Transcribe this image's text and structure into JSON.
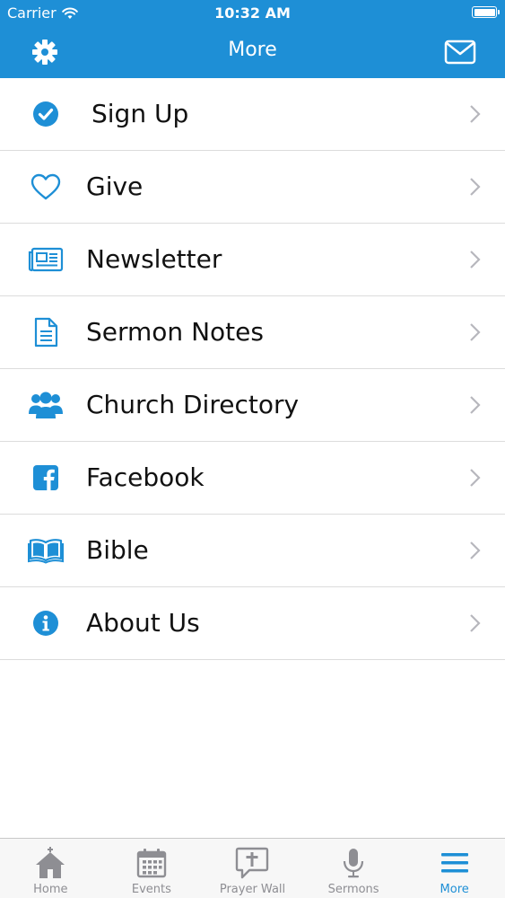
{
  "status_bar": {
    "carrier": "Carrier",
    "time": "10:32 AM",
    "wifi_icon": "wifi-icon",
    "battery_icon": "battery-icon"
  },
  "nav_bar": {
    "title": "More",
    "left_icon": "gear-icon",
    "right_icon": "mail-icon"
  },
  "colors": {
    "brand_blue": "#1E8FD6",
    "tab_inactive": "#8e8e93",
    "divider": "#dcdcdc"
  },
  "menu": {
    "items": [
      {
        "label": "Sign Up",
        "icon": "check-circle-icon"
      },
      {
        "label": "Give",
        "icon": "heart-icon"
      },
      {
        "label": "Newsletter",
        "icon": "newspaper-icon"
      },
      {
        "label": "Sermon Notes",
        "icon": "document-icon"
      },
      {
        "label": "Church Directory",
        "icon": "people-icon"
      },
      {
        "label": "Facebook",
        "icon": "facebook-icon"
      },
      {
        "label": "Bible",
        "icon": "open-book-icon"
      },
      {
        "label": "About Us",
        "icon": "info-icon"
      }
    ]
  },
  "tab_bar": {
    "active": "More",
    "tabs": [
      {
        "label": "Home",
        "icon": "church-icon"
      },
      {
        "label": "Events",
        "icon": "calendar-icon"
      },
      {
        "label": "Prayer Wall",
        "icon": "cross-speech-bubble-icon"
      },
      {
        "label": "Sermons",
        "icon": "microphone-icon"
      },
      {
        "label": "More",
        "icon": "hamburger-menu-icon"
      }
    ]
  }
}
